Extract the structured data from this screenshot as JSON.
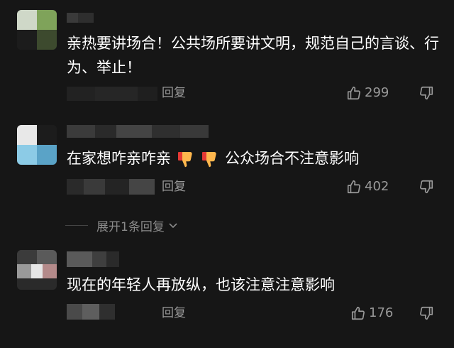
{
  "comments": [
    {
      "username": "",
      "text": "亲热要讲场合！公共场所要讲文明，规范自己的言谈、行为、举止！",
      "reply_label": "回复",
      "likes": "299"
    },
    {
      "username": "",
      "text_before": "在家想咋亲咋亲",
      "text_after": "公众场合不注意影响",
      "reply_label": "回复",
      "likes": "402",
      "expand_label": "展开1条回复"
    },
    {
      "username": "",
      "text": "现在的年轻人再放纵，也该注意注意影响",
      "reply_label": "回复",
      "likes": "176"
    }
  ],
  "icons": {
    "like": "thumbs-up-icon",
    "dislike": "thumbs-down-icon",
    "expand": "chevron-down-icon",
    "emoji": "thumbs-down-emoji"
  },
  "colors": {
    "background": "#161616",
    "text": "#ffffff",
    "secondary": "#9a9a9a"
  }
}
